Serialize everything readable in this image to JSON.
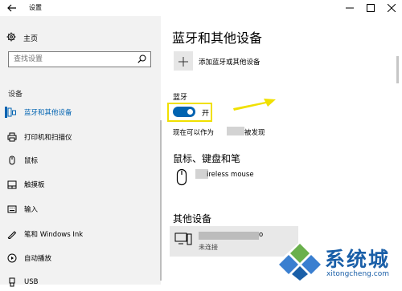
{
  "window": {
    "title": "设置"
  },
  "sidebar": {
    "home_label": "主页",
    "search_placeholder": "查找设置",
    "section_label": "设备",
    "items": [
      {
        "label": "蓝牙和其他设备",
        "active": true
      },
      {
        "label": "打印机和扫描仪"
      },
      {
        "label": "鼠标"
      },
      {
        "label": "触摸板"
      },
      {
        "label": "输入"
      },
      {
        "label": "笔和 Windows Ink"
      },
      {
        "label": "自动播放"
      },
      {
        "label": "USB"
      }
    ]
  },
  "main": {
    "title": "蓝牙和其他设备",
    "add_device_label": "添加蓝牙或其他设备",
    "bluetooth_label": "蓝牙",
    "toggle_state": "开",
    "discoverable_prefix": "现在可以作为",
    "discoverable_suffix": "被发现",
    "mouse_section_title": "鼠标、键盘和笔",
    "mouse_device_name": "ireless mouse",
    "other_section_title": "其他设备",
    "other_device_tail": "o",
    "other_device_status": "未连接"
  },
  "colors": {
    "accent": "#0063b1",
    "highlight": "#f0e000",
    "watermark": "#1a5fa8"
  },
  "watermark": {
    "brand": "系统城",
    "url": "xitongcheng.com"
  }
}
